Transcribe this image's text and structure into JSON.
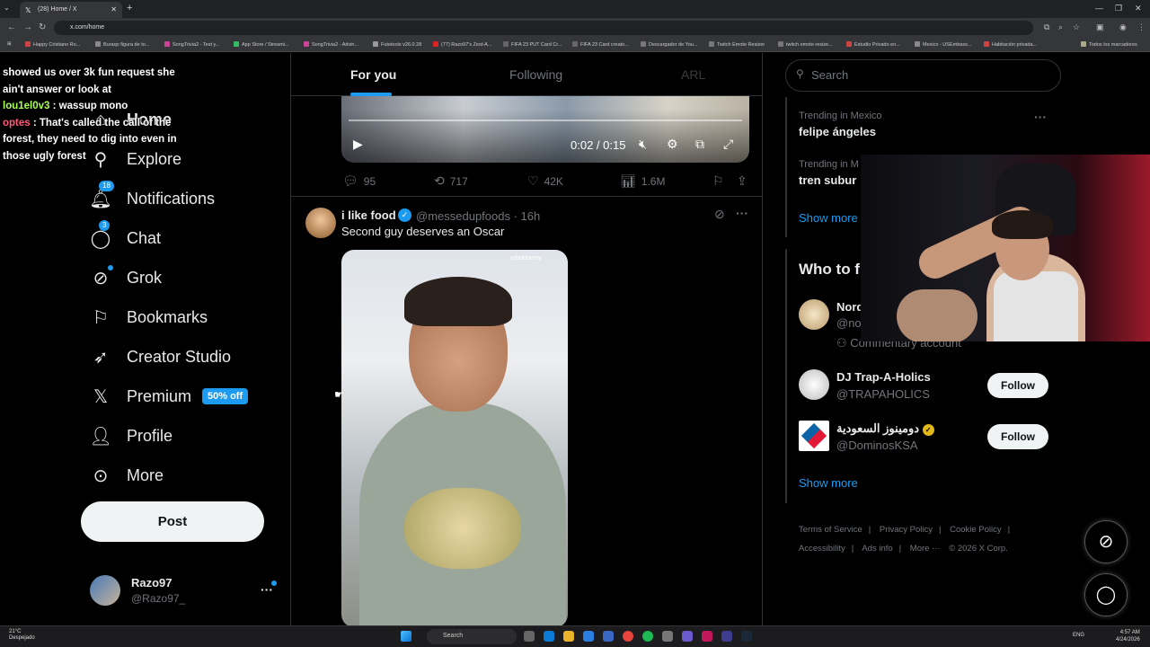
{
  "browser": {
    "tab_title": "(28) Home / X",
    "url": "x.com/home",
    "bookmarks": [
      "Happy Cristiano Ro...",
      "Buraqo figura de to...",
      "SongTrivia2 - Test y...",
      "App Store / Streami...",
      "SongTrivia2 - Advin...",
      "Futetools v26.0.28",
      "(77) Razo97's Zest-A...",
      "FIFA 23 PUT Card Cr...",
      "FIFA 23 Card creato...",
      "Descargador de You...",
      "Twitch Emote Resizer",
      "twitch emote resize...",
      "Estudio Privado en...",
      "Mexico - USEmbass...",
      "Habitación privada..."
    ],
    "bookmarks_all": "Todos los marcadores"
  },
  "chat_overlay": {
    "line1": "showed us over 3k fun request she ain't answer or look at",
    "user2": "lou1el0v3",
    "msg2": ": wassup mono",
    "user3": "optes",
    "msg3": ": That's called the call of the forest, they need to dig into even in those ugly forest"
  },
  "nav": {
    "home": "Home",
    "explore": "Explore",
    "notifications": "Notifications",
    "notifications_count": "18",
    "chat": "Chat",
    "chat_count": "3",
    "grok": "Grok",
    "bookmarks": "Bookmarks",
    "creator_studio": "Creator Studio",
    "premium": "Premium",
    "premium_badge": "50% off",
    "profile": "Profile",
    "more": "More",
    "post": "Post",
    "account_name": "Razo97",
    "account_handle": "@Razo97_"
  },
  "feed": {
    "tabs": [
      "For you",
      "Following",
      "ARL"
    ],
    "video_time": "0:02 / 0:15",
    "prev_replies": "95",
    "prev_reposts": "717",
    "prev_likes": "42K",
    "prev_views": "1.6M",
    "tweet": {
      "name": "i like food",
      "handle": "@messedupfoods · 16h",
      "text": "Second guy deserves an Oscar",
      "watermark": "robdelaney"
    }
  },
  "right": {
    "search_placeholder": "Search",
    "trends": [
      {
        "category": "Trending in Mexico",
        "name": "felipe ángeles"
      },
      {
        "category": "Trending in M",
        "name": "tren subur"
      }
    ],
    "show_more": "Show more",
    "who_to_follow": "Who to f",
    "suggestions": [
      {
        "name": "Nord",
        "handle": "@no",
        "note": "Commentary account"
      },
      {
        "name": "DJ Trap-A-Holics",
        "handle": "@TRAPAHOLICS",
        "button": "Follow"
      },
      {
        "name": "دومينوز السعودية",
        "handle": "@DominosKSA",
        "button": "Follow"
      }
    ],
    "footer": [
      "Terms of Service",
      "|",
      "Privacy Policy",
      "|",
      "Cookie Policy",
      "|",
      "Accessibility",
      "|",
      "Ads info",
      "|",
      "More ···",
      "© 2026 X Corp."
    ]
  },
  "taskbar": {
    "weather_temp": "21°C",
    "weather_desc": "Despejado",
    "search": "Search",
    "lang": "ENG",
    "time": "4:57 AM",
    "date": "4/24/2026"
  },
  "colors": {
    "accent": "#1d9bf0",
    "background": "#000000",
    "border": "#2f3336",
    "muted": "#71767b"
  }
}
